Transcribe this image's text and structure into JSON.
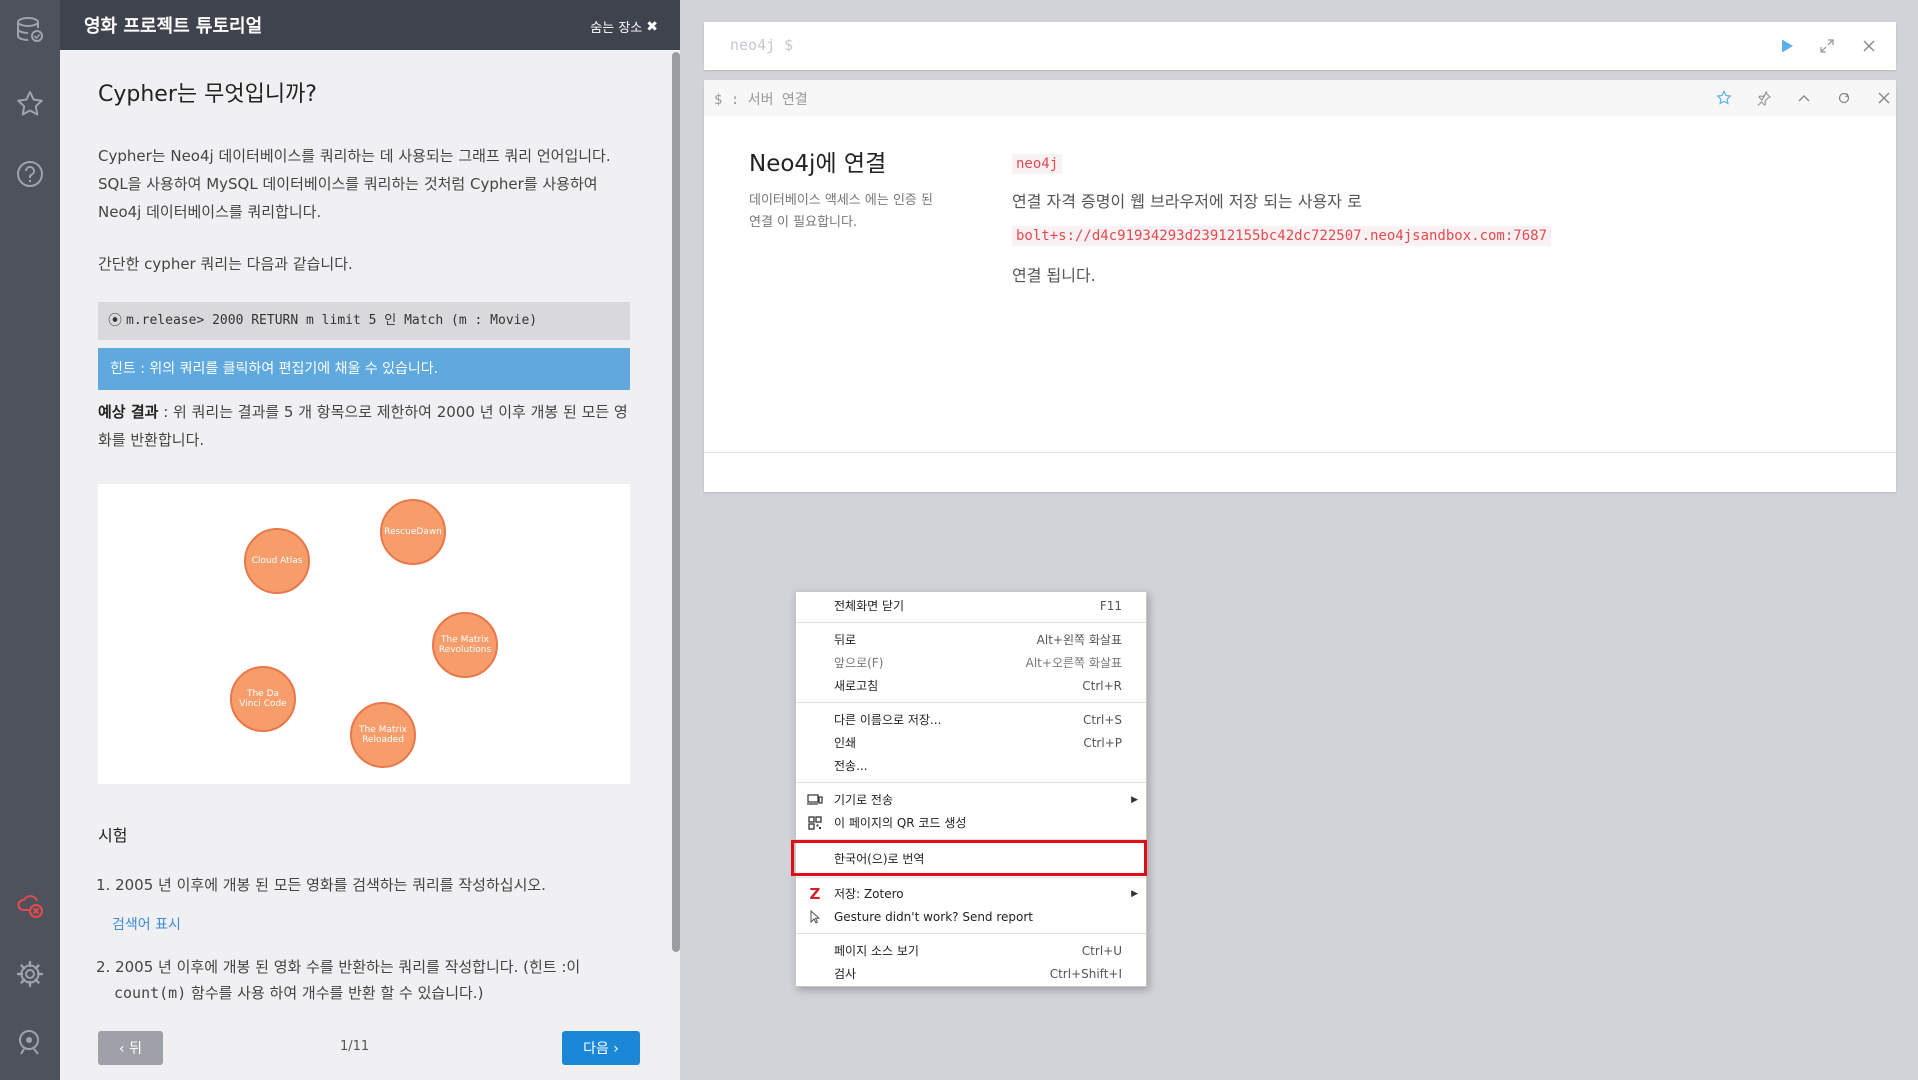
{
  "guide": {
    "title": "영화 프로젝트 튜토리얼",
    "undock_label": "숨는 장소",
    "heading": "Cypher는 무엇입니까?",
    "intro": "Cypher는 Neo4j 데이터베이스를 쿼리하는 데 사용되는 그래프 쿼리 언어입니다. SQL을 사용하여 MySQL 데이터베이스를 쿼리하는 것처럼 Cypher를 사용하여 Neo4j 데이터베이스를 쿼리합니다.",
    "simple_query_intro": "간단한 cypher 쿼리는 다음과 같습니다.",
    "code_example": "m.release> 2000 RETURN m limit 5 인 Match (m : Movie)",
    "hint": "힌트 : 위의 쿼리를 클릭하여 편집기에 채울 수 있습니다.",
    "expected_label": "예상 결과",
    "expected_text": " : 위 쿼리는 결과를 5 개 항목으로 제한하여 2000 년 이후 개봉 된 모든 영화를 반환합니다.",
    "graph_nodes": [
      "RescueDawn",
      "Cloud Atlas",
      "The Matrix Revolutions",
      "The Da Vinci Code",
      "The Matrix Reloaded"
    ],
    "exercise_heading": "시험",
    "exercise_1": "1. 2005 년 이후에 개봉 된 모든 영화를 검색하는 쿼리를 작성하십시오.",
    "show_solution": "검색어 표시",
    "exercise_2_a": "2. 2005 년 이후에 개봉 된 영화 수를 반환하는 쿼리를 작성합니다. (힌트 :이",
    "exercise_2_b_code": "count(m)",
    "exercise_2_b_rest": " 함수를 사용 하여 개수를 반환 할 수 있습니다.)",
    "prev_label": "‹ 뒤",
    "page": "1/11",
    "next_label": "다음 ›"
  },
  "editor": {
    "prompt": "neo4j $"
  },
  "frame": {
    "command": "$ : 서버 연결",
    "conn_title": "Neo4j에 연결",
    "conn_desc": "데이터베이스 액세스 에는 인증 된 연결 이 필요합니다.",
    "username": "neo4j",
    "stored_text": "연결 자격 증명이 웹 브라우저에 저장 되는 사용자 로",
    "url": "bolt+s://d4c91934293d23912155bc42dc722507.neo4jsandbox.com:7687",
    "connected": "연결 됩니다."
  },
  "context_menu": {
    "items": [
      {
        "label": "전체화면 닫기",
        "shortcut": "F11"
      },
      {
        "label": "뒤로",
        "shortcut": "Alt+왼쪽 화살표"
      },
      {
        "label": "앞으로(F)",
        "shortcut": "Alt+오른쪽 화살표"
      },
      {
        "label": "새로고침",
        "shortcut": "Ctrl+R"
      },
      {
        "label": "다른 이름으로 저장...",
        "shortcut": "Ctrl+S"
      },
      {
        "label": "인쇄",
        "shortcut": "Ctrl+P"
      },
      {
        "label": "전송...",
        "shortcut": ""
      },
      {
        "label": "기기로 전송",
        "shortcut": ""
      },
      {
        "label": "이 페이지의 QR 코드 생성",
        "shortcut": ""
      },
      {
        "label": "한국어(으)로 번역",
        "shortcut": ""
      },
      {
        "label": "저장: Zotero",
        "shortcut": ""
      },
      {
        "label": "Gesture didn't work? Send report",
        "shortcut": ""
      },
      {
        "label": "페이지 소스 보기",
        "shortcut": "Ctrl+U"
      },
      {
        "label": "검사",
        "shortcut": "Ctrl+Shift+I"
      }
    ]
  },
  "colors": {
    "rail": "#4d525d",
    "guide_header": "#3f434d",
    "hint_bg": "#5fa9df",
    "next_button": "#1a87d7",
    "node_fill": "#f79d6b",
    "highlight_box": "#e00c15"
  }
}
